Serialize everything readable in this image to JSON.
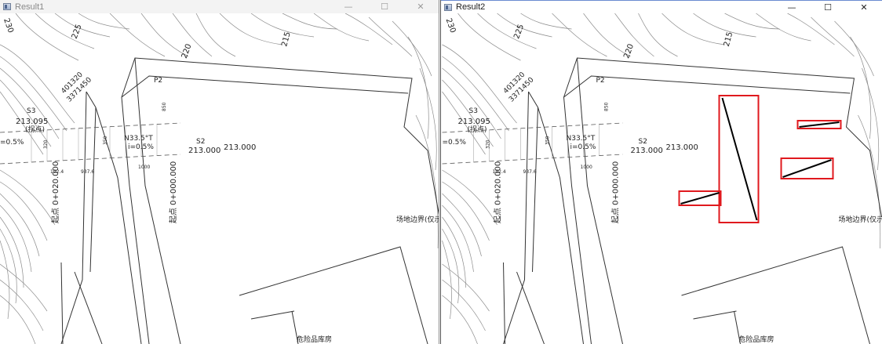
{
  "windows": [
    {
      "title": "Result1",
      "controls": {
        "minimize": "—",
        "maximize": "☐",
        "close": "✕"
      }
    },
    {
      "title": "Result2",
      "controls": {
        "minimize": "—",
        "maximize": "☐",
        "close": "✕"
      }
    }
  ],
  "drawing": {
    "contours": [
      "230",
      "225",
      "220",
      "215"
    ],
    "coord_n": "401320",
    "coord_e": "3371450",
    "point_p2": "P2",
    "s3": "S3",
    "s3_elev": "213.095",
    "s3_note": "(拐点)",
    "s2": "S2",
    "s2_elev": "213.000",
    "elev_center": "213.000",
    "heading": "N33.5°T",
    "slope_mid": "i=0.5%",
    "slope_left": "=0.5%",
    "dim_102": "102.4",
    "dim_937": "937.6",
    "dim_1000": "1000",
    "dim_350": "350",
    "dim_320": "320",
    "dim_850": "850",
    "chainage_1": "起点 0+020.000",
    "chainage_2": "起点 0+000.000",
    "site_label": "场地边界(仅示意)",
    "tank_label": "危险品库房"
  },
  "detections": {
    "color": "#e0191e",
    "count": 4
  }
}
